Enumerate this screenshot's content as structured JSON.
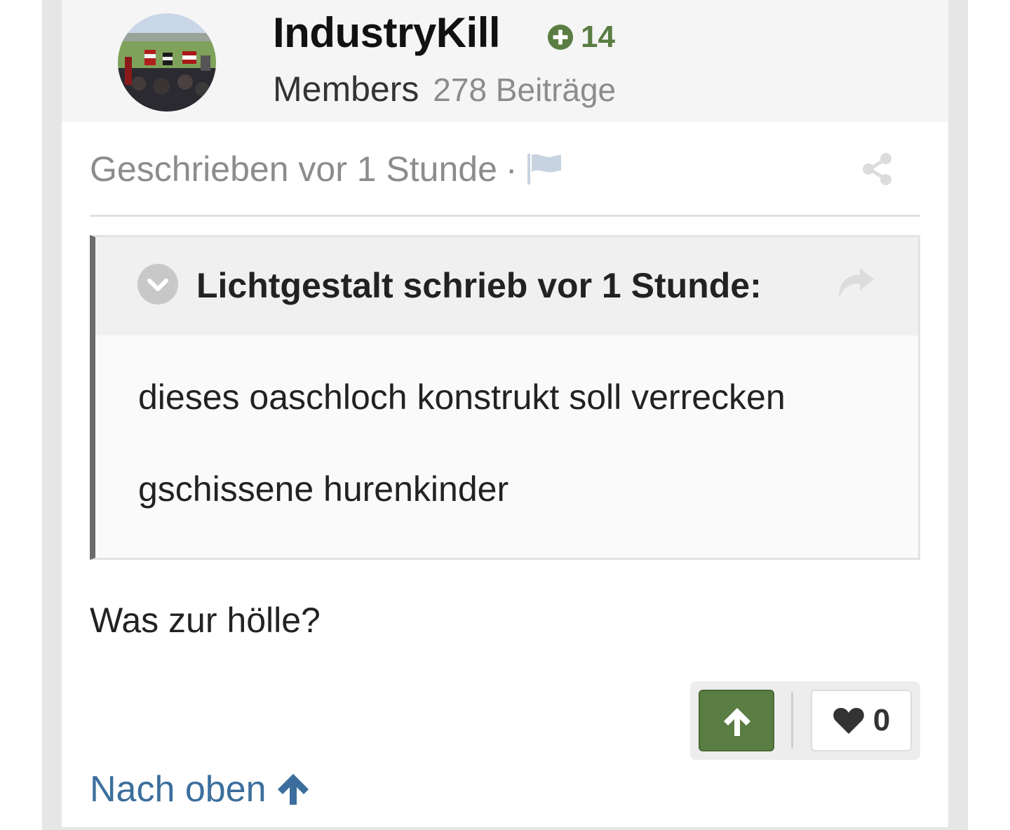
{
  "author": {
    "username": "IndustryKill",
    "reputation": "14",
    "group": "Members",
    "post_count": "278 Beiträge",
    "avatar_icon": "avatar-photo"
  },
  "post": {
    "meta_text": "Geschrieben vor 1 Stunde",
    "meta_separator": "·",
    "report_icon": "flag-icon",
    "share_icon": "share-icon",
    "quote": {
      "citation": "Lichtgestalt schrieb vor 1 Stunde:",
      "lines": [
        "dieses oaschloch konstrukt soll verrecken",
        "gschissene hurenkinder"
      ]
    },
    "reply": "Was zur hölle?"
  },
  "reactions": {
    "upvote_icon": "arrow-up-icon",
    "like_icon": "heart-icon",
    "like_count": "0"
  },
  "footer": {
    "back_to_top": "Nach oben"
  },
  "colors": {
    "reputation": "#5a7d43",
    "upvote": "#5a7d43",
    "link": "#3b6e9c",
    "muted_text": "#8c8c8c",
    "quote_border": "#6b6b6b"
  }
}
